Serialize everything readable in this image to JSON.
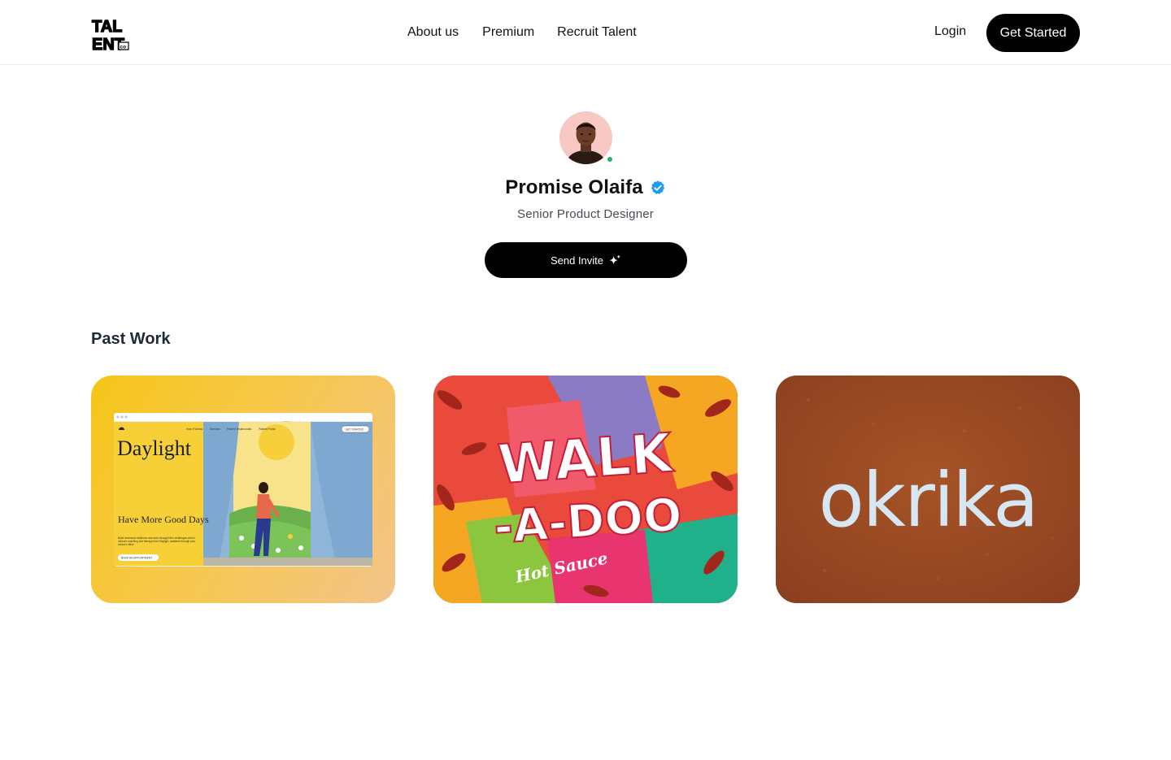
{
  "header": {
    "logo": {
      "icon": "talent-logo",
      "lines": [
        "TAL",
        "ENT"
      ],
      "badge": "co"
    },
    "nav": [
      "About us",
      "Premium",
      "Recruit Talent"
    ],
    "login_label": "Login",
    "cta_label": "Get Started"
  },
  "profile": {
    "name": "Promise Olaifa",
    "role": "Senior Product Designer",
    "verified_icon": "verified-badge-icon",
    "status": "online",
    "invite_label": "Send Invite",
    "invite_icon": "sparkle-icon"
  },
  "past_work": {
    "title": "Past Work",
    "items": [
      {
        "name": "Daylight",
        "headline": "Have More Good Days",
        "body": "Build emotional resilience and work through life's challenges with in network coaching and therapy from Daylight, available through your doctor's office",
        "cta": "BOOK AN APPOINTMENT",
        "nav": [
          "How It Works",
          "Services",
          "Patient Testimonials",
          "Patient Portal"
        ],
        "nav_cta": "GET STARTED"
      },
      {
        "lines": [
          "WALK",
          "-A-DOO"
        ],
        "subtitle": "Hot Sauce"
      },
      {
        "wordmark": "okrika"
      }
    ]
  },
  "colors": {
    "accent": "#000000",
    "verified": "#1d9bf0",
    "online": "#22b573",
    "card_daylight": "#f5c518",
    "card_walkadoo": "#e94a3c",
    "card_okrika": "#9a4a23"
  }
}
